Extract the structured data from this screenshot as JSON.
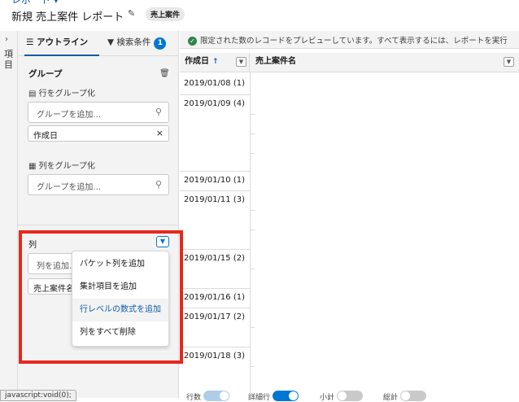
{
  "header": {
    "breadcrumb": "レポート ▾",
    "title": "新規 売上案件 レポート",
    "report_type": "売上案件",
    "edit_icon": "pencil-icon"
  },
  "left_strip": {
    "label": "項目",
    "chevron": "›"
  },
  "panel": {
    "tabs": {
      "outline": "アウトライン",
      "filters": "検索条件",
      "filter_count": "1"
    },
    "groups": {
      "title": "グループ",
      "rows_label": "行をグループ化",
      "rows_placeholder": "グループを追加...",
      "rows_group": "作成日",
      "cols_label": "列をグループ化",
      "cols_placeholder": "グループを追加..."
    },
    "columns": {
      "title": "列",
      "placeholder": "列を追加...",
      "field": "売上案件名"
    },
    "menu": [
      "バケット列を追加",
      "集計項目を追加",
      "行レベルの数式を追加",
      "列をすべて削除"
    ]
  },
  "preview": {
    "notice": "限定された数のレコードをプレビューしています。すべて表示するには、レポートを実行",
    "columns": [
      "作成日",
      "売上案件名"
    ],
    "sort_arrow": "↑",
    "rows": [
      "2019/01/08 (1)",
      "2019/01/09 (4)",
      "2019/01/10 (1)",
      "2019/01/11 (3)",
      "2019/01/15 (2)",
      "2019/01/16 (1)",
      "2019/01/17 (2)",
      "2019/01/18 (3)"
    ]
  },
  "footer": {
    "row_count": "行数",
    "detail_rows": "詳細行",
    "subtotals": "小計",
    "grand_total": "総計"
  },
  "status_url": "javascript:void(0);",
  "colors": {
    "brand": "#0176d3",
    "highlight": "#e8271b",
    "success": "#2e844a"
  }
}
